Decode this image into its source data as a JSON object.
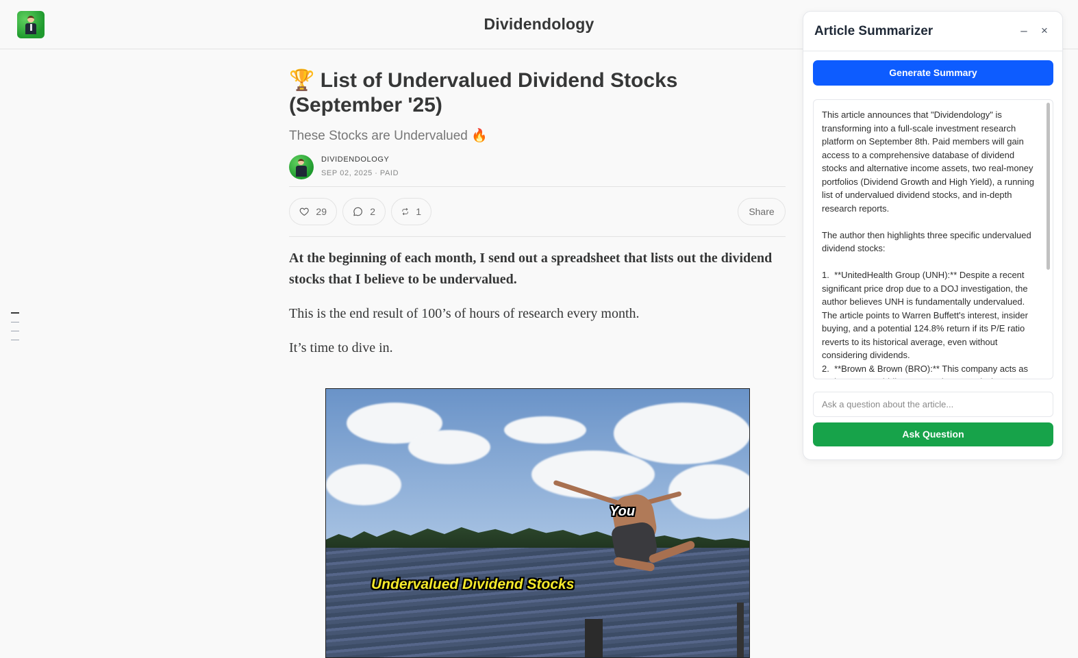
{
  "header": {
    "site_title": "Dividendology"
  },
  "post": {
    "title": "🏆 List of Undervalued Dividend Stocks (September '25)",
    "subtitle": "These Stocks are Undervalued 🔥",
    "author": "DIVIDENDOLOGY",
    "meta": "SEP 02, 2025 ∙ PAID",
    "likes": "29",
    "comments": "2",
    "restacks": "1",
    "share_label": "Share",
    "paragraphs": [
      "At the beginning of each month, I send out a spreadsheet that lists out the dividend stocks that I believe to be undervalued.",
      "This is the end result of 100’s of hours of research every month.",
      "It’s time to dive in."
    ],
    "image": {
      "caption_you": "You",
      "caption_stocks": "Undervalued Dividend Stocks"
    }
  },
  "summarizer": {
    "title": "Article Summarizer",
    "minimize": "–",
    "close": "×",
    "generate_label": "Generate Summary",
    "summary": "This article announces that \"Dividendology\" is transforming into a full-scale investment research platform on September 8th. Paid members will gain access to a comprehensive database of dividend stocks and alternative income assets, two real-money portfolios (Dividend Growth and High Yield), a running list of undervalued dividend stocks, and in-depth research reports.\n\nThe author then highlights three specific undervalued dividend stocks:\n\n1.  **UnitedHealth Group (UNH):** Despite a recent significant price drop due to a DOJ investigation, the author believes UNH is fundamentally undervalued. The article points to Warren Buffett's interest, insider buying, and a potential 124.8% return if its P/E ratio reverts to its historical average, even without considering dividends.\n2.  **Brown & Brown (BRO):** This company acts as an insurance middleman, earning commissions",
    "ask_placeholder": "Ask a question about the article...",
    "ask_label": "Ask Question"
  }
}
